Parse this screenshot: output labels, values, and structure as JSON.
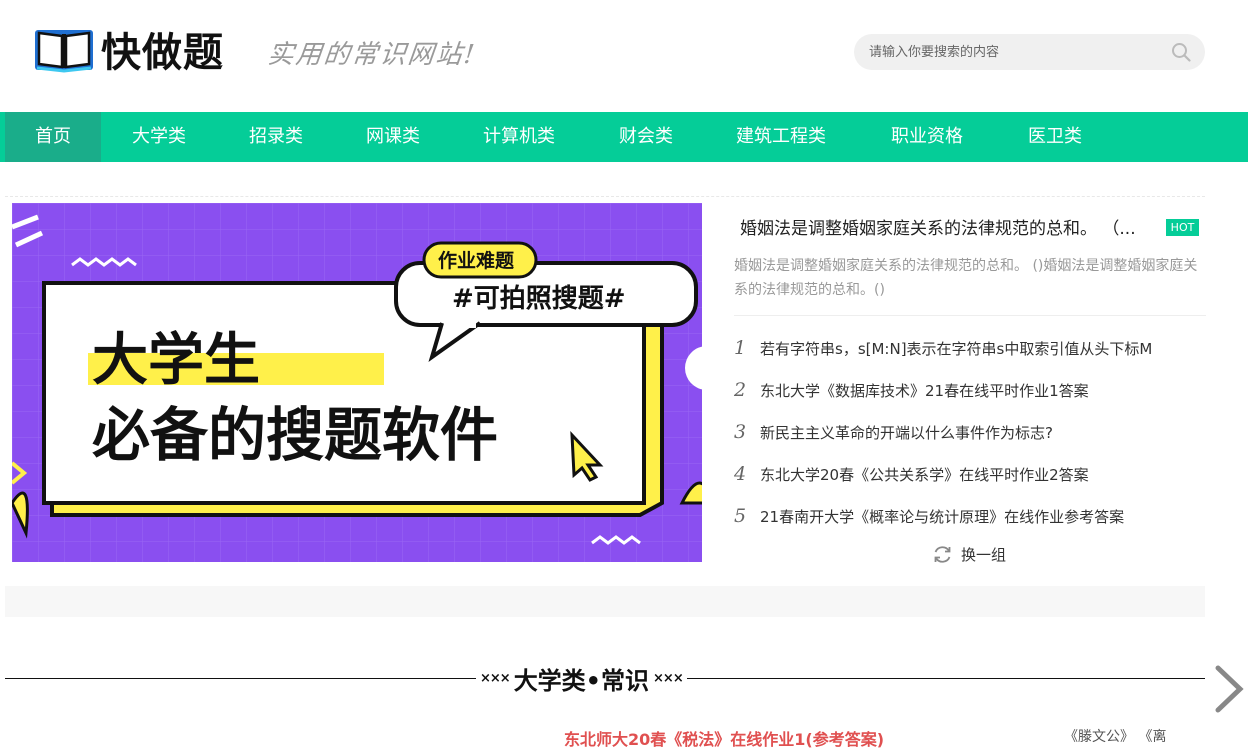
{
  "site": {
    "name": "快做题",
    "slogan": "实用的常识网站!"
  },
  "search": {
    "placeholder": "请输入你要搜索的内容"
  },
  "nav": {
    "items": [
      "首页",
      "大学类",
      "招录类",
      "网课类",
      "计算机类",
      "财会类",
      "建筑工程类",
      "职业资格",
      "医卫类"
    ],
    "active": "首页"
  },
  "banner": {
    "bubble_label": "作业难题",
    "bubble_text": "#可拍照搜题#",
    "headline_line1": "大学生",
    "headline_line2": "必备的搜题软件"
  },
  "hot": {
    "title": "婚姻法是调整婚姻家庭关系的法律规范的总和。 （...",
    "badge": "HOT",
    "description": "婚姻法是调整婚姻家庭关系的法律规范的总和。 ()婚姻法是调整婚姻家庭关系的法律规范的总和。()"
  },
  "rank_list": [
    {
      "num": "1",
      "title": "若有字符串s，s[M:N]表示在字符串s中取索引值从头下标M"
    },
    {
      "num": "2",
      "title": "东北大学《数据库技术》21春在线平时作业1答案"
    },
    {
      "num": "3",
      "title": "新民主主义革命的开端以什么事件作为标志?"
    },
    {
      "num": "4",
      "title": "东北大学20春《公共关系学》在线平时作业2答案"
    },
    {
      "num": "5",
      "title": "21春南开大学《概率论与统计原理》在线作业参考答案"
    }
  ],
  "refresh_label": "换一组",
  "section": {
    "title": "大学类•常识",
    "deco_left": "×××",
    "deco_right": "×××"
  },
  "bottom": {
    "article": "东北师大20春《税法》在线作业1(参考答案)",
    "right_text": "《滕文公》 《离"
  },
  "colors": {
    "accent": "#05cd98",
    "nav_active": "#1aad8a",
    "hot_badge": "#05cd98",
    "banner_bg": "#8a4ff0",
    "banner_yellow": "#fff04a"
  }
}
